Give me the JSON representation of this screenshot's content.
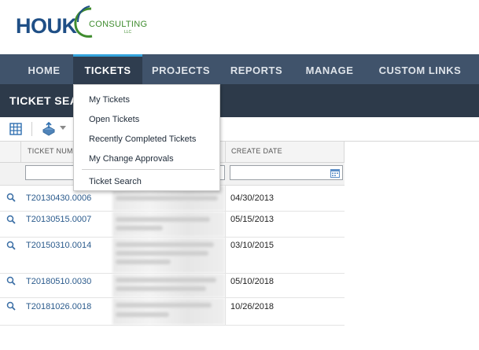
{
  "logo": {
    "brand": "HOUK",
    "sub": "CONSULTING",
    "suffix": "LLC"
  },
  "nav": {
    "items": [
      {
        "label": "HOME"
      },
      {
        "label": "TICKETS",
        "active": true
      },
      {
        "label": "PROJECTS"
      },
      {
        "label": "REPORTS"
      },
      {
        "label": "MANAGE"
      },
      {
        "label": "CUSTOM LINKS"
      }
    ]
  },
  "page_title": "TICKET SEA",
  "toolbar": {
    "icons": [
      "grid-icon",
      "export-icon",
      "chevron-down-icon"
    ]
  },
  "grid": {
    "columns": {
      "ticket_number": "TICKET NUMB",
      "create_date": "CREATE DATE"
    },
    "filters": {
      "ticket_number": "",
      "create_date": ""
    },
    "rows": [
      {
        "ticket": "T20130430.0006",
        "date": "04/30/2013"
      },
      {
        "ticket": "T20130515.0007",
        "date": "05/15/2013"
      },
      {
        "ticket": "T20150310.0014",
        "date": "03/10/2015"
      },
      {
        "ticket": "T20180510.0030",
        "date": "05/10/2018"
      },
      {
        "ticket": "T20181026.0018",
        "date": "10/26/2018"
      }
    ]
  },
  "dropdown": {
    "items": [
      {
        "label": "My Tickets"
      },
      {
        "label": "Open Tickets"
      },
      {
        "label": "Recently Completed Tickets"
      },
      {
        "label": "My Change Approvals"
      },
      {
        "label": "Ticket Search"
      }
    ]
  },
  "colors": {
    "nav_bg": "#40536b",
    "title_bg": "#2d3a4a",
    "accent": "#33a3dc",
    "link": "#2a5a8c"
  }
}
